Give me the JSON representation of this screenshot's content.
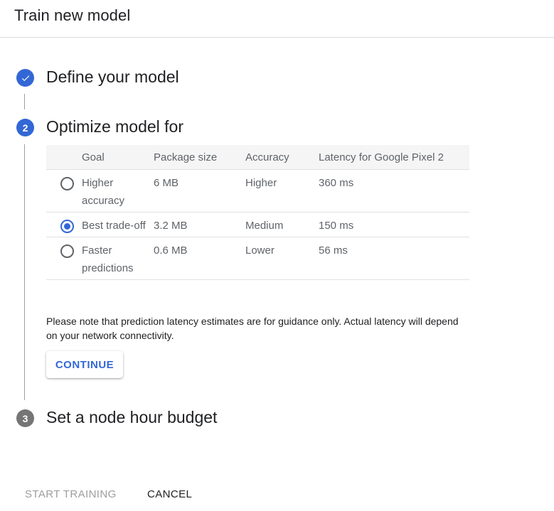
{
  "header": {
    "title": "Train new model"
  },
  "steps": [
    {
      "number": "",
      "title": "Define your model",
      "state": "done"
    },
    {
      "number": "2",
      "title": "Optimize model for",
      "state": "active"
    },
    {
      "number": "3",
      "title": "Set a node hour budget",
      "state": "pending"
    }
  ],
  "table": {
    "headers": [
      "Goal",
      "Package size",
      "Accuracy",
      "Latency for Google Pixel 2"
    ],
    "rows": [
      {
        "goal": "Higher accuracy",
        "size": "6 MB",
        "accuracy": "Higher",
        "latency": "360 ms",
        "selected": false
      },
      {
        "goal": "Best trade-off",
        "size": "3.2 MB",
        "accuracy": "Medium",
        "latency": "150 ms",
        "selected": true
      },
      {
        "goal": "Faster predictions",
        "size": "0.6 MB",
        "accuracy": "Lower",
        "latency": "56 ms",
        "selected": false
      }
    ]
  },
  "note": "Please note that prediction latency estimates are for guidance only. Actual latency will depend on your network connectivity.",
  "continue_label": "CONTINUE",
  "footer": {
    "start_label": "START TRAINING",
    "cancel_label": "CANCEL"
  },
  "colors": {
    "accent": "#3367d6",
    "pending": "#757575",
    "disabled_text": "#9e9e9e"
  }
}
